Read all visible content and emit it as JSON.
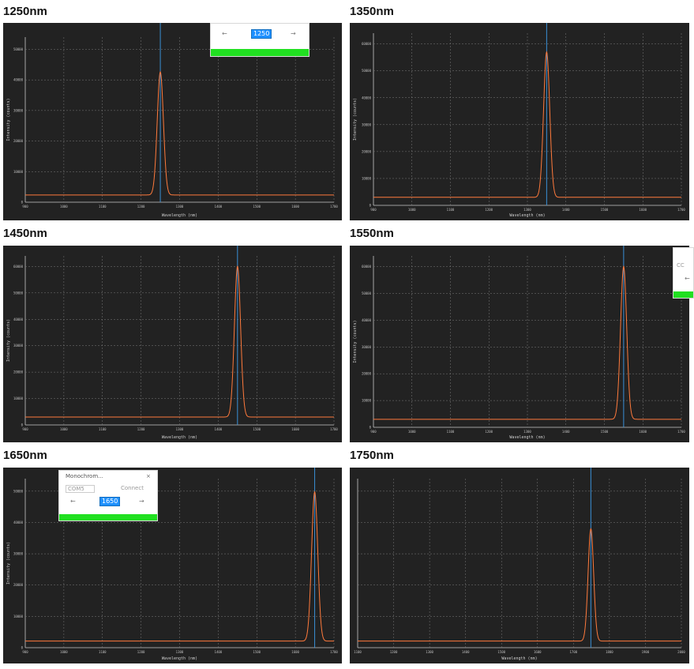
{
  "panels": [
    {
      "title": "1250nm",
      "ylabel": "Intensity (counts)",
      "xlabel": "Wavelength (nm)",
      "yticks": [
        "0",
        "10000",
        "20000",
        "30000",
        "40000",
        "50000"
      ],
      "xticks": [
        "900",
        "1000",
        "1100",
        "1200",
        "1300",
        "1400",
        "1500",
        "1600",
        "1700"
      ],
      "chart_data": {
        "type": "line",
        "peak_x": 1250,
        "peak_y": 45000,
        "baseline_y": 2500,
        "xlim": [
          900,
          1700
        ],
        "ylim": [
          0,
          57000
        ]
      }
    },
    {
      "title": "1350nm",
      "ylabel": "Intensity (counts)",
      "xlabel": "Wavelength (nm)",
      "yticks": [
        "0",
        "10000",
        "20000",
        "30000",
        "40000",
        "50000",
        "60000"
      ],
      "xticks": [
        "900",
        "1000",
        "1100",
        "1200",
        "1300",
        "1400",
        "1500",
        "1600",
        "1700"
      ],
      "chart_data": {
        "type": "line",
        "peak_x": 1350,
        "peak_y": 57000,
        "baseline_y": 3000,
        "xlim": [
          900,
          1700
        ],
        "ylim": [
          0,
          64000
        ]
      }
    },
    {
      "title": "1450nm",
      "ylabel": "Intensity (counts)",
      "xlabel": "Wavelength (nm)",
      "yticks": [
        "0",
        "10000",
        "20000",
        "30000",
        "40000",
        "50000",
        "60000"
      ],
      "xticks": [
        "900",
        "1000",
        "1100",
        "1200",
        "1300",
        "1400",
        "1500",
        "1600",
        "1700"
      ],
      "chart_data": {
        "type": "line",
        "peak_x": 1450,
        "peak_y": 60000,
        "baseline_y": 3000,
        "xlim": [
          900,
          1700
        ],
        "ylim": [
          0,
          64000
        ]
      }
    },
    {
      "title": "1550nm",
      "ylabel": "Intensity (counts)",
      "xlabel": "Wavelength (nm)",
      "yticks": [
        "0",
        "10000",
        "20000",
        "30000",
        "40000",
        "50000",
        "60000"
      ],
      "xticks": [
        "900",
        "1000",
        "1100",
        "1200",
        "1300",
        "1400",
        "1500",
        "1600",
        "1700"
      ],
      "chart_data": {
        "type": "line",
        "peak_x": 1550,
        "peak_y": 60000,
        "baseline_y": 3000,
        "xlim": [
          900,
          1700
        ],
        "ylim": [
          0,
          64000
        ]
      }
    },
    {
      "title": "1650nm",
      "ylabel": "Intensity (counts)",
      "xlabel": "Wavelength (nm)",
      "yticks": [
        "0",
        "10000",
        "20000",
        "30000",
        "40000",
        "50000"
      ],
      "xticks": [
        "900",
        "1000",
        "1100",
        "1200",
        "1300",
        "1400",
        "1500",
        "1600",
        "1700"
      ],
      "chart_data": {
        "type": "line",
        "peak_x": 1650,
        "peak_y": 59000,
        "baseline_y": 2500,
        "xlim": [
          900,
          1700
        ],
        "ylim": [
          0,
          64000
        ]
      }
    },
    {
      "title": "1750nm",
      "ylabel": "",
      "xlabel": "Wavelength (nm)",
      "yticks": [],
      "xticks": [
        "1100",
        "1200",
        "1300",
        "1400",
        "1500",
        "1600",
        "1700",
        "1800",
        "1900",
        "2000"
      ],
      "chart_data": {
        "type": "line",
        "peak_x": 1750,
        "peak_y": 45000,
        "baseline_y": 2500,
        "xlim": [
          1080,
          2010
        ],
        "ylim": [
          0,
          64000
        ]
      }
    }
  ],
  "overlays": {
    "p1": {
      "left_arrow": "←",
      "value": "1250",
      "right_arrow": "→"
    },
    "p4": {
      "text": "CC",
      "arrow": "←"
    },
    "p5": {
      "title": "Monochrom...",
      "port": "COM5",
      "connect": "Connect",
      "close": "×",
      "left_arrow": "←",
      "value": "1650",
      "right_arrow": "→"
    }
  },
  "colors": {
    "bg": "#222222",
    "grid": "#7a7a7a",
    "trace": "#ff7a3c",
    "marker": "#3a8fd6",
    "progress": "#21e021"
  }
}
